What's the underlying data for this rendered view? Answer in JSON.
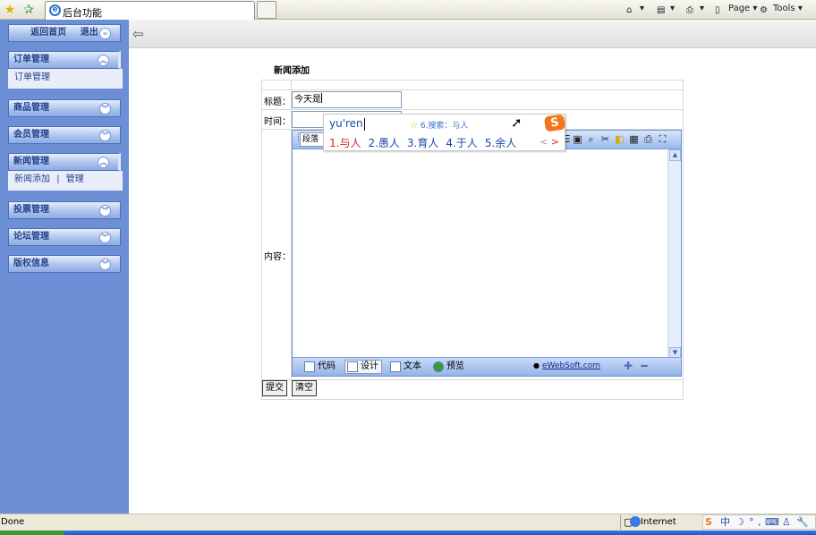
{
  "browser": {
    "tab_title": "后台功能",
    "page_label": "Page",
    "tools_label": "Tools",
    "status_text": "Done",
    "zone_text": "Internet"
  },
  "sidebar": {
    "top_home": "返回首页",
    "top_logout": "退出",
    "sections": [
      {
        "label": "订单管理",
        "open": true,
        "sub": [
          "订单管理"
        ]
      },
      {
        "label": "商品管理"
      },
      {
        "label": "会员管理"
      },
      {
        "label": "新闻管理",
        "open": true,
        "sub": [
          "新闻添加",
          "|",
          "管理"
        ]
      },
      {
        "label": "投票管理"
      },
      {
        "label": "论坛管理"
      },
      {
        "label": "版权信息"
      }
    ]
  },
  "form": {
    "page_title": "新闻添加",
    "title_label": "标题：",
    "title_value": "今天是",
    "time_label": "时间：",
    "time_value": "",
    "content_label": "内容：",
    "submit_label": "提交",
    "clear_label": "清空"
  },
  "editor": {
    "para_label": "段落样",
    "modes": [
      "代码",
      "设计",
      "文本",
      "预览"
    ],
    "active_mode": "设计",
    "brand_link": "eWebSoft.com"
  },
  "ime": {
    "pinyin": "yu'ren",
    "search_hint": "6.搜索：与人",
    "candidates": [
      "1.与人",
      "2.愚人",
      "3.育人",
      "4.于人",
      "5.余人"
    ],
    "prev": "<",
    "next": ">"
  },
  "colors": {
    "sidebar_bg": "#6d8fd6",
    "ime_highlight": "#e0232a",
    "ime_text": "#1a49a8",
    "sogou_brand": "#f2751a"
  }
}
